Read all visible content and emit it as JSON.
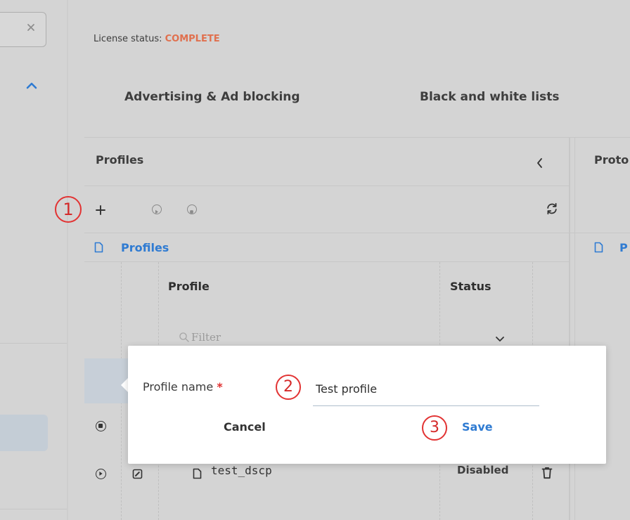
{
  "header": {
    "license_label": "License status:",
    "license_value": "COMPLETE"
  },
  "tabs": [
    {
      "label": "Advertising & Ad blocking"
    },
    {
      "label": "Black and white lists"
    }
  ],
  "profiles_panel": {
    "title": "Profiles",
    "tree_root": "Profiles",
    "columns": {
      "profile": "Profile",
      "status": "Status"
    },
    "filter_placeholder": "Filter",
    "rows": [
      {
        "name": "test_dscp",
        "status": "Disabled"
      }
    ]
  },
  "right_panel": {
    "title": "Proto",
    "tree_root": "P"
  },
  "dialog": {
    "label": "Profile name",
    "required_mark": "*",
    "input_value": "Test profile",
    "cancel": "Cancel",
    "save": "Save"
  },
  "annotations": {
    "step1": "1",
    "step2": "2",
    "step3": "3"
  },
  "colors": {
    "accent": "#2f7bd2",
    "license": "#e0704e",
    "annotation": "#e23333"
  }
}
